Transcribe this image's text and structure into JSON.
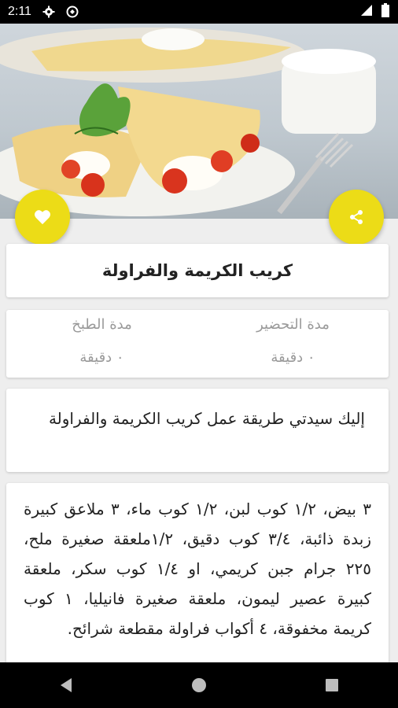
{
  "status_bar": {
    "time": "2:11",
    "icons": [
      "settings-icon",
      "sync-icon",
      "signal-icon",
      "battery-icon"
    ]
  },
  "hero": {
    "image": "crepe-strawberry-cream-photo"
  },
  "actions": {
    "favorite_icon": "heart-icon",
    "share_icon": "share-icon",
    "accent": "#ecdc17"
  },
  "recipe": {
    "title": "كريب الكريمة والفراولة",
    "prep_label": "مدة التحضير",
    "prep_value": "٠ دقيقة",
    "cook_label": "مدة الطبخ",
    "cook_value": "٠ دقيقة",
    "intro": "إليك سيدتي طريقة عمل كريب الكريمة والفراولة",
    "ingredients": "٣ بيض، ١/٢ كوب لبن، ١/٢ كوب ماء، ٣ ملاعق كبيرة زبدة ذائبة، ٣/٤ كوب دقيق، ١/٢ملعقة صغيرة ملح، ٢٢٥ جرام جبن كريمي، او ١/٤ كوب سكر، ملعقة كبيرة عصير ليمون، ملعقة صغيرة فانيليا، ١ كوب كريمة مخفوقة، ٤ أكواب فراولة مقطعة شرائح."
  },
  "nav_bar": {
    "buttons": [
      "back-icon",
      "home-icon",
      "recents-icon"
    ]
  }
}
